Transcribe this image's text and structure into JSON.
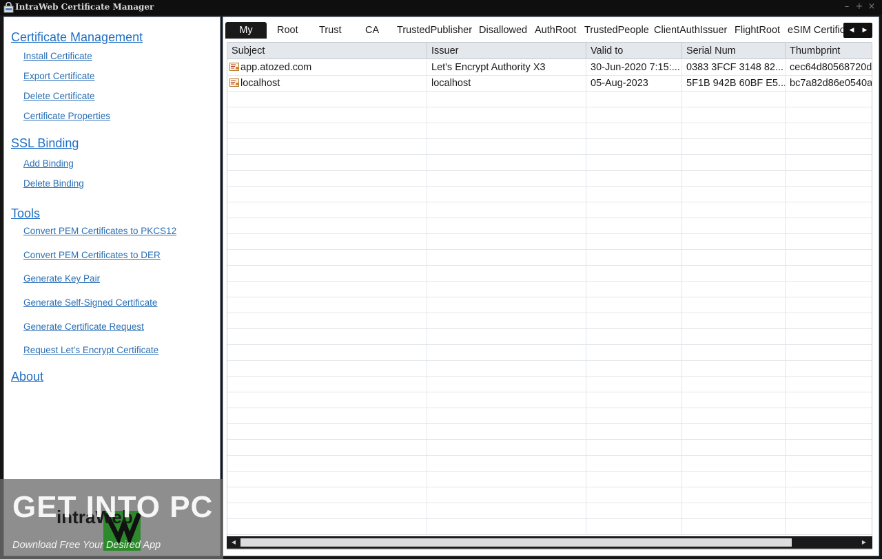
{
  "window": {
    "title": "IntraWeb Certificate Manager",
    "controls": [
      "–",
      "+",
      "×"
    ]
  },
  "sidebar": {
    "sections": [
      {
        "label": "Certificate Management",
        "items": [
          "Install Certificate",
          "Export Certificate",
          "Delete Certificate",
          "Certificate Properties"
        ]
      },
      {
        "label": "SSL Binding",
        "items": [
          "Add Binding",
          "Delete Binding"
        ]
      },
      {
        "label": "Tools",
        "items": [
          "Convert PEM Certificates to PKCS12",
          "Convert PEM Certificates to DER",
          "Generate Key Pair",
          "Generate Self-Signed Certificate",
          "Generate Certificate Request",
          "Request Let's Encrypt Certificate"
        ]
      },
      {
        "label": "About",
        "items": []
      }
    ]
  },
  "tabs": {
    "active": "My",
    "labels": [
      "My",
      "Root",
      "Trust",
      "CA",
      "TrustedPublisher",
      "Disallowed",
      "AuthRoot",
      "TrustedPeople",
      "ClientAuthIssuer",
      "FlightRoot",
      "eSIM Certification"
    ],
    "left_arrow": "◀",
    "right_arrow": "▶"
  },
  "grid": {
    "columns": [
      "Subject",
      "Issuer",
      "Valid to",
      "Serial Num",
      "Thumbprint"
    ],
    "rows": [
      [
        "app.atozed.com",
        "Let's Encrypt Authority X3",
        "30-Jun-2020 7:15:...",
        "0383 3FCF 3148 82...",
        "cec64d80568720d"
      ],
      [
        "localhost",
        "localhost",
        "05-Aug-2023",
        "5F1B 942B 60BF E5...",
        "bc7a82d86e0540a"
      ]
    ]
  },
  "watermark": {
    "title": "GET INTO PC",
    "subtitle": "Download Free Your Desired App",
    "logo_text": "intraWeb"
  },
  "colors": {
    "link": "#2a6fb5",
    "section": "#1f6fc4",
    "titlebar": "#0f0f0f",
    "active_tab": "#1a1a1a"
  }
}
